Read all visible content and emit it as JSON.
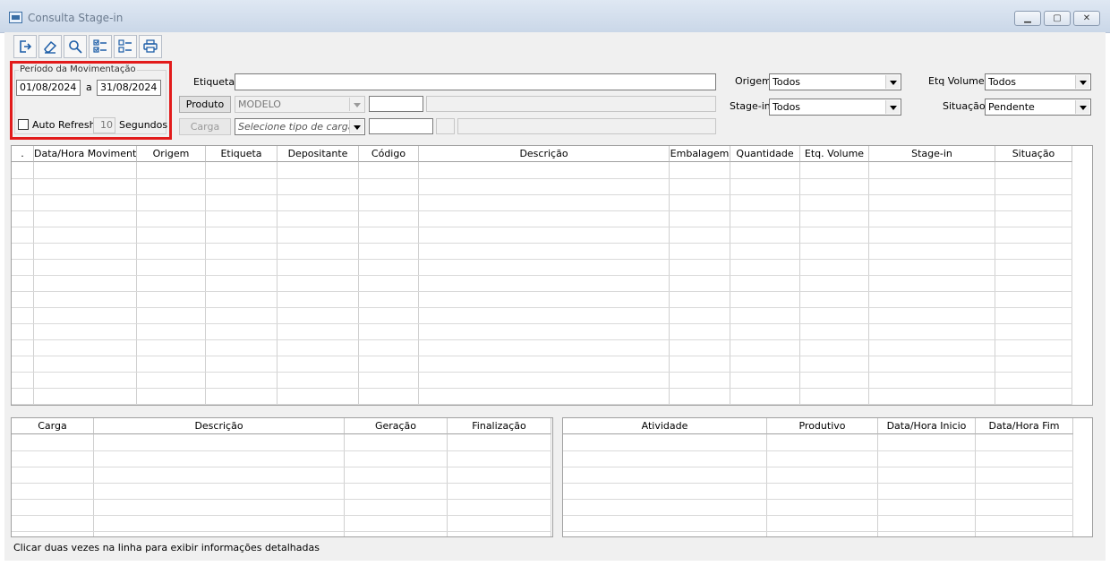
{
  "window": {
    "title": "Consulta Stage-in",
    "controls": [
      "minimize-icon",
      "maximize-icon",
      "close-icon"
    ]
  },
  "toolbar": {
    "buttons": [
      {
        "icon": "exit-icon"
      },
      {
        "icon": "eraser-icon"
      },
      {
        "icon": "search-icon"
      },
      {
        "icon": "checklist-icon"
      },
      {
        "icon": "list-icon"
      },
      {
        "icon": "printer-icon"
      }
    ]
  },
  "period": {
    "title": "Período da Movimentação",
    "from": "01/08/2024",
    "separator": "a",
    "to": "31/08/2024",
    "auto_refresh_label": "Auto Refresh",
    "auto_refresh_checked": false,
    "refresh_value": "10",
    "seconds_label": "Segundos"
  },
  "filters": {
    "etiqueta_label": "Etiqueta",
    "etiqueta_value": "",
    "produto_button": "Produto",
    "produto_value": "MODELO",
    "carga_button": "Carga",
    "carga_placeholder": "Selecione tipo de carga",
    "origem_label": "Origem",
    "origem_value": "Todos",
    "stagein_label": "Stage-in",
    "stagein_value": "Todos",
    "etq_volumes_label": "Etq Volumes",
    "etq_volumes_value": "Todos",
    "situacao_label": "Situação",
    "situacao_value": "Pendente"
  },
  "main_grid": {
    "columns": [
      ".",
      "Data/Hora Movimento",
      "Origem",
      "Etiqueta",
      "Depositante",
      "Código",
      "Descrição",
      "Embalagem",
      "Quantidade",
      "Etq. Volume",
      "Stage-in",
      "Situação"
    ],
    "rows": []
  },
  "carga_grid": {
    "columns": [
      "Carga",
      "Descrição",
      "Geração",
      "Finalização"
    ],
    "rows": []
  },
  "atividade_grid": {
    "columns": [
      "Atividade",
      "Produtivo",
      "Data/Hora Inicio",
      "Data/Hora Fim"
    ],
    "rows": []
  },
  "status": {
    "hint": "Clicar duas vezes na linha para exibir informações detalhadas"
  },
  "colors": {
    "highlight_border": "#e21b1b",
    "toolbar_icon": "#1f5fa8"
  }
}
